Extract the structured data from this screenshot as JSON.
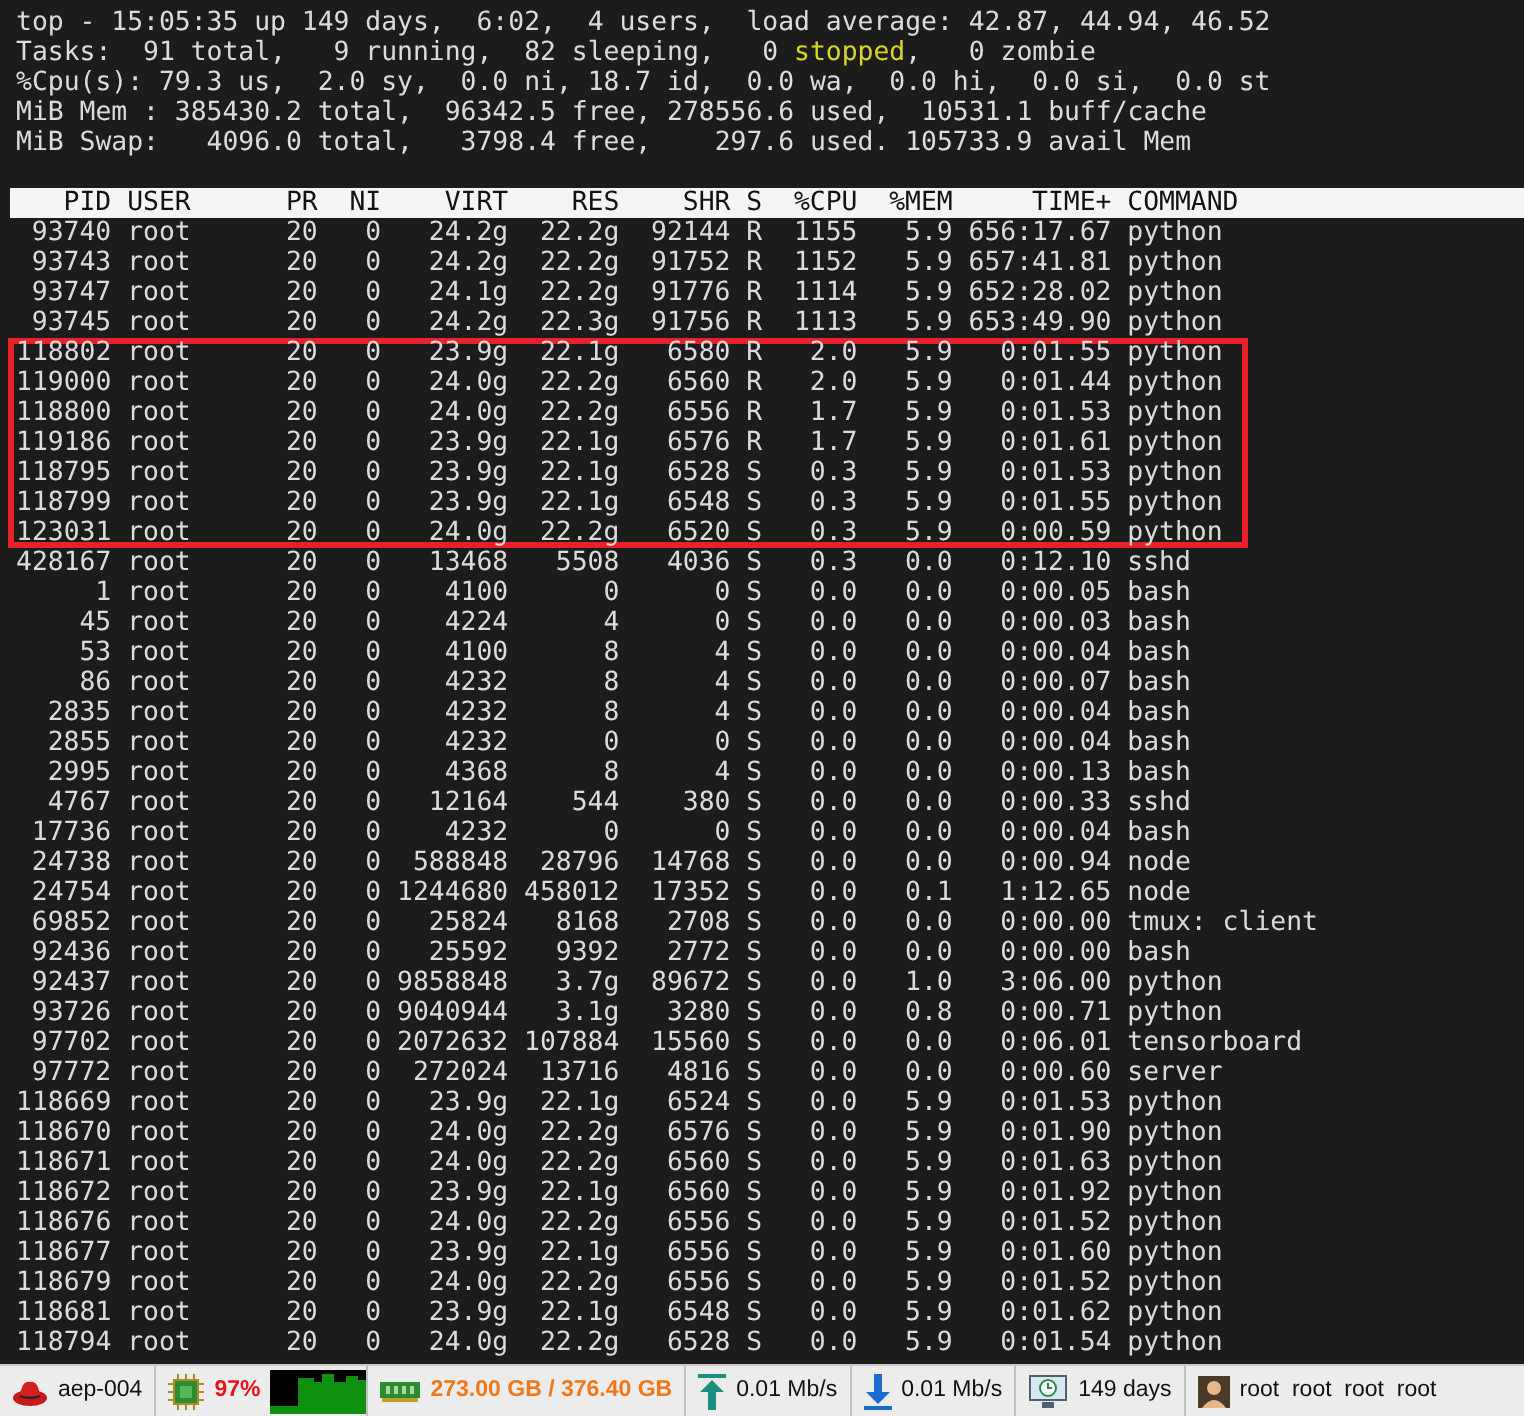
{
  "summary": [
    {
      "parts": [
        {
          "text": "top - 15:05:35 up 149 days,  6:02,  4 users,  load average: 42.87, 44.94, 46.52",
          "highlight": false
        }
      ]
    },
    {
      "parts": [
        {
          "text": "Tasks:  91 total,   9 running,  82 sleeping,   0 ",
          "highlight": false
        },
        {
          "text": "stopped",
          "highlight": true
        },
        {
          "text": ",   0 zombie",
          "highlight": false
        }
      ]
    },
    {
      "parts": [
        {
          "text": "%Cpu(s): 79.3 us,  2.0 sy,  0.0 ni, 18.7 id,  0.0 wa,  0.0 hi,  0.0 si,  0.0 st",
          "highlight": false
        }
      ]
    },
    {
      "parts": [
        {
          "text": "MiB Mem : 385430.2 total,  96342.5 free, 278556.6 used,  10531.1 buff/cache",
          "highlight": false
        }
      ]
    },
    {
      "parts": [
        {
          "text": "MiB Swap:   4096.0 total,   3798.4 free,    297.6 used. 105733.9 avail Mem",
          "highlight": false
        }
      ]
    }
  ],
  "table": {
    "columns": [
      "PID",
      "USER",
      "PR",
      "NI",
      "VIRT",
      "RES",
      "SHR",
      "S",
      "%CPU",
      "%MEM",
      "TIME+",
      "COMMAND"
    ],
    "rows": [
      {
        "cells": [
          "93740",
          "root",
          "20",
          "0",
          "24.2g",
          "22.2g",
          "92144",
          "R",
          "1155",
          "5.9",
          "656:17.67",
          "python"
        ],
        "highlighted": false
      },
      {
        "cells": [
          "93743",
          "root",
          "20",
          "0",
          "24.2g",
          "22.2g",
          "91752",
          "R",
          "1152",
          "5.9",
          "657:41.81",
          "python"
        ],
        "highlighted": false
      },
      {
        "cells": [
          "93747",
          "root",
          "20",
          "0",
          "24.1g",
          "22.2g",
          "91776",
          "R",
          "1114",
          "5.9",
          "652:28.02",
          "python"
        ],
        "highlighted": false
      },
      {
        "cells": [
          "93745",
          "root",
          "20",
          "0",
          "24.2g",
          "22.3g",
          "91756",
          "R",
          "1113",
          "5.9",
          "653:49.90",
          "python"
        ],
        "highlighted": false
      },
      {
        "cells": [
          "118802",
          "root",
          "20",
          "0",
          "23.9g",
          "22.1g",
          "6580",
          "R",
          "2.0",
          "5.9",
          "0:01.55",
          "python"
        ],
        "highlighted": true
      },
      {
        "cells": [
          "119000",
          "root",
          "20",
          "0",
          "24.0g",
          "22.2g",
          "6560",
          "R",
          "2.0",
          "5.9",
          "0:01.44",
          "python"
        ],
        "highlighted": true
      },
      {
        "cells": [
          "118800",
          "root",
          "20",
          "0",
          "24.0g",
          "22.2g",
          "6556",
          "R",
          "1.7",
          "5.9",
          "0:01.53",
          "python"
        ],
        "highlighted": true
      },
      {
        "cells": [
          "119186",
          "root",
          "20",
          "0",
          "23.9g",
          "22.1g",
          "6576",
          "R",
          "1.7",
          "5.9",
          "0:01.61",
          "python"
        ],
        "highlighted": true
      },
      {
        "cells": [
          "118795",
          "root",
          "20",
          "0",
          "23.9g",
          "22.1g",
          "6528",
          "S",
          "0.3",
          "5.9",
          "0:01.53",
          "python"
        ],
        "highlighted": true
      },
      {
        "cells": [
          "118799",
          "root",
          "20",
          "0",
          "23.9g",
          "22.1g",
          "6548",
          "S",
          "0.3",
          "5.9",
          "0:01.55",
          "python"
        ],
        "highlighted": true
      },
      {
        "cells": [
          "123031",
          "root",
          "20",
          "0",
          "24.0g",
          "22.2g",
          "6520",
          "S",
          "0.3",
          "5.9",
          "0:00.59",
          "python"
        ],
        "highlighted": true
      },
      {
        "cells": [
          "428167",
          "root",
          "20",
          "0",
          "13468",
          "5508",
          "4036",
          "S",
          "0.3",
          "0.0",
          "0:12.10",
          "sshd"
        ],
        "highlighted": false
      },
      {
        "cells": [
          "1",
          "root",
          "20",
          "0",
          "4100",
          "0",
          "0",
          "S",
          "0.0",
          "0.0",
          "0:00.05",
          "bash"
        ],
        "highlighted": false
      },
      {
        "cells": [
          "45",
          "root",
          "20",
          "0",
          "4224",
          "4",
          "0",
          "S",
          "0.0",
          "0.0",
          "0:00.03",
          "bash"
        ],
        "highlighted": false
      },
      {
        "cells": [
          "53",
          "root",
          "20",
          "0",
          "4100",
          "8",
          "4",
          "S",
          "0.0",
          "0.0",
          "0:00.04",
          "bash"
        ],
        "highlighted": false
      },
      {
        "cells": [
          "86",
          "root",
          "20",
          "0",
          "4232",
          "8",
          "4",
          "S",
          "0.0",
          "0.0",
          "0:00.07",
          "bash"
        ],
        "highlighted": false
      },
      {
        "cells": [
          "2835",
          "root",
          "20",
          "0",
          "4232",
          "8",
          "4",
          "S",
          "0.0",
          "0.0",
          "0:00.04",
          "bash"
        ],
        "highlighted": false
      },
      {
        "cells": [
          "2855",
          "root",
          "20",
          "0",
          "4232",
          "0",
          "0",
          "S",
          "0.0",
          "0.0",
          "0:00.04",
          "bash"
        ],
        "highlighted": false
      },
      {
        "cells": [
          "2995",
          "root",
          "20",
          "0",
          "4368",
          "8",
          "4",
          "S",
          "0.0",
          "0.0",
          "0:00.13",
          "bash"
        ],
        "highlighted": false
      },
      {
        "cells": [
          "4767",
          "root",
          "20",
          "0",
          "12164",
          "544",
          "380",
          "S",
          "0.0",
          "0.0",
          "0:00.33",
          "sshd"
        ],
        "highlighted": false
      },
      {
        "cells": [
          "17736",
          "root",
          "20",
          "0",
          "4232",
          "0",
          "0",
          "S",
          "0.0",
          "0.0",
          "0:00.04",
          "bash"
        ],
        "highlighted": false
      },
      {
        "cells": [
          "24738",
          "root",
          "20",
          "0",
          "588848",
          "28796",
          "14768",
          "S",
          "0.0",
          "0.0",
          "0:00.94",
          "node"
        ],
        "highlighted": false
      },
      {
        "cells": [
          "24754",
          "root",
          "20",
          "0",
          "1244680",
          "458012",
          "17352",
          "S",
          "0.0",
          "0.1",
          "1:12.65",
          "node"
        ],
        "highlighted": false
      },
      {
        "cells": [
          "69852",
          "root",
          "20",
          "0",
          "25824",
          "8168",
          "2708",
          "S",
          "0.0",
          "0.0",
          "0:00.00",
          "tmux: client"
        ],
        "highlighted": false
      },
      {
        "cells": [
          "92436",
          "root",
          "20",
          "0",
          "25592",
          "9392",
          "2772",
          "S",
          "0.0",
          "0.0",
          "0:00.00",
          "bash"
        ],
        "highlighted": false
      },
      {
        "cells": [
          "92437",
          "root",
          "20",
          "0",
          "9858848",
          "3.7g",
          "89672",
          "S",
          "0.0",
          "1.0",
          "3:06.00",
          "python"
        ],
        "highlighted": false
      },
      {
        "cells": [
          "93726",
          "root",
          "20",
          "0",
          "9040944",
          "3.1g",
          "3280",
          "S",
          "0.0",
          "0.8",
          "0:00.71",
          "python"
        ],
        "highlighted": false
      },
      {
        "cells": [
          "97702",
          "root",
          "20",
          "0",
          "2072632",
          "107884",
          "15560",
          "S",
          "0.0",
          "0.0",
          "0:06.01",
          "tensorboard"
        ],
        "highlighted": false
      },
      {
        "cells": [
          "97772",
          "root",
          "20",
          "0",
          "272024",
          "13716",
          "4816",
          "S",
          "0.0",
          "0.0",
          "0:00.60",
          "server"
        ],
        "highlighted": false
      },
      {
        "cells": [
          "118669",
          "root",
          "20",
          "0",
          "23.9g",
          "22.1g",
          "6524",
          "S",
          "0.0",
          "5.9",
          "0:01.53",
          "python"
        ],
        "highlighted": false
      },
      {
        "cells": [
          "118670",
          "root",
          "20",
          "0",
          "24.0g",
          "22.2g",
          "6576",
          "S",
          "0.0",
          "5.9",
          "0:01.90",
          "python"
        ],
        "highlighted": false
      },
      {
        "cells": [
          "118671",
          "root",
          "20",
          "0",
          "24.0g",
          "22.2g",
          "6560",
          "S",
          "0.0",
          "5.9",
          "0:01.63",
          "python"
        ],
        "highlighted": false
      },
      {
        "cells": [
          "118672",
          "root",
          "20",
          "0",
          "23.9g",
          "22.1g",
          "6560",
          "S",
          "0.0",
          "5.9",
          "0:01.92",
          "python"
        ],
        "highlighted": false
      },
      {
        "cells": [
          "118676",
          "root",
          "20",
          "0",
          "24.0g",
          "22.2g",
          "6556",
          "S",
          "0.0",
          "5.9",
          "0:01.52",
          "python"
        ],
        "highlighted": false
      },
      {
        "cells": [
          "118677",
          "root",
          "20",
          "0",
          "23.9g",
          "22.1g",
          "6556",
          "S",
          "0.0",
          "5.9",
          "0:01.60",
          "python"
        ],
        "highlighted": false
      },
      {
        "cells": [
          "118679",
          "root",
          "20",
          "0",
          "24.0g",
          "22.2g",
          "6556",
          "S",
          "0.0",
          "5.9",
          "0:01.52",
          "python"
        ],
        "highlighted": false
      },
      {
        "cells": [
          "118681",
          "root",
          "20",
          "0",
          "23.9g",
          "22.1g",
          "6548",
          "S",
          "0.0",
          "5.9",
          "0:01.62",
          "python"
        ],
        "highlighted": false
      },
      {
        "cells": [
          "118794",
          "root",
          "20",
          "0",
          "24.0g",
          "22.2g",
          "6528",
          "S",
          "0.0",
          "5.9",
          "0:01.54",
          "python"
        ],
        "highlighted": false
      }
    ]
  },
  "status_bar": [
    {
      "kind": "host",
      "text": "aep-004"
    },
    {
      "kind": "cpu",
      "text": "97%",
      "color": "#e8141a"
    },
    {
      "kind": "graph"
    },
    {
      "kind": "memory",
      "text": "273.00 GB / 376.40 GB",
      "color": "#f07818"
    },
    {
      "kind": "upload",
      "text": "0.01 Mb/s"
    },
    {
      "kind": "download",
      "text": "0.01 Mb/s"
    },
    {
      "kind": "uptime",
      "text": "149 days"
    },
    {
      "kind": "users",
      "text": "root  root  root  root"
    }
  ]
}
